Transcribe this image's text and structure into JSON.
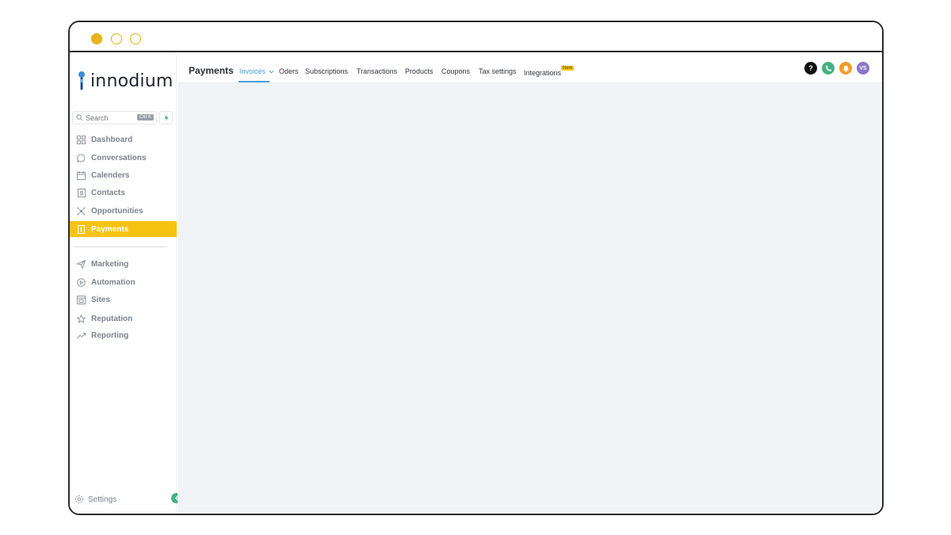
{
  "brand": {
    "name": "innodium"
  },
  "search": {
    "placeholder": "Search",
    "shortcut": "Ctrl K"
  },
  "sidebar": {
    "items": [
      {
        "label": "Dashboard",
        "icon": "dashboard-icon"
      },
      {
        "label": "Conversations",
        "icon": "chat-icon"
      },
      {
        "label": "Calenders",
        "icon": "calendar-icon"
      },
      {
        "label": "Contacts",
        "icon": "contacts-icon"
      },
      {
        "label": "Opportunities",
        "icon": "opportunities-icon"
      },
      {
        "label": "Payments",
        "icon": "payments-icon",
        "active": true
      }
    ],
    "items2": [
      {
        "label": "Marketing",
        "icon": "send-icon"
      },
      {
        "label": "Automation",
        "icon": "automation-icon"
      },
      {
        "label": "Sites",
        "icon": "sites-icon"
      },
      {
        "label": "Reputation",
        "icon": "star-icon"
      },
      {
        "label": "Reporting",
        "icon": "reporting-icon"
      }
    ],
    "settings_label": "Settings"
  },
  "topnav": {
    "title": "Payments",
    "tabs": [
      {
        "label": "Invoices",
        "active": true,
        "dropdown": true
      },
      {
        "label": "Oders"
      },
      {
        "label": "Subscriptions"
      },
      {
        "label": "Transactions"
      },
      {
        "label": "Products"
      },
      {
        "label": "Coupons"
      },
      {
        "label": "Tax settings"
      },
      {
        "label": "Integrations",
        "badge": "New"
      }
    ],
    "help_label": "?",
    "avatar_initials": "VS"
  },
  "colors": {
    "accent": "#f7c313",
    "link": "#4c9ed9",
    "phone": "#3fb37f",
    "bell": "#f39c26",
    "avatar": "#8a74c8"
  }
}
